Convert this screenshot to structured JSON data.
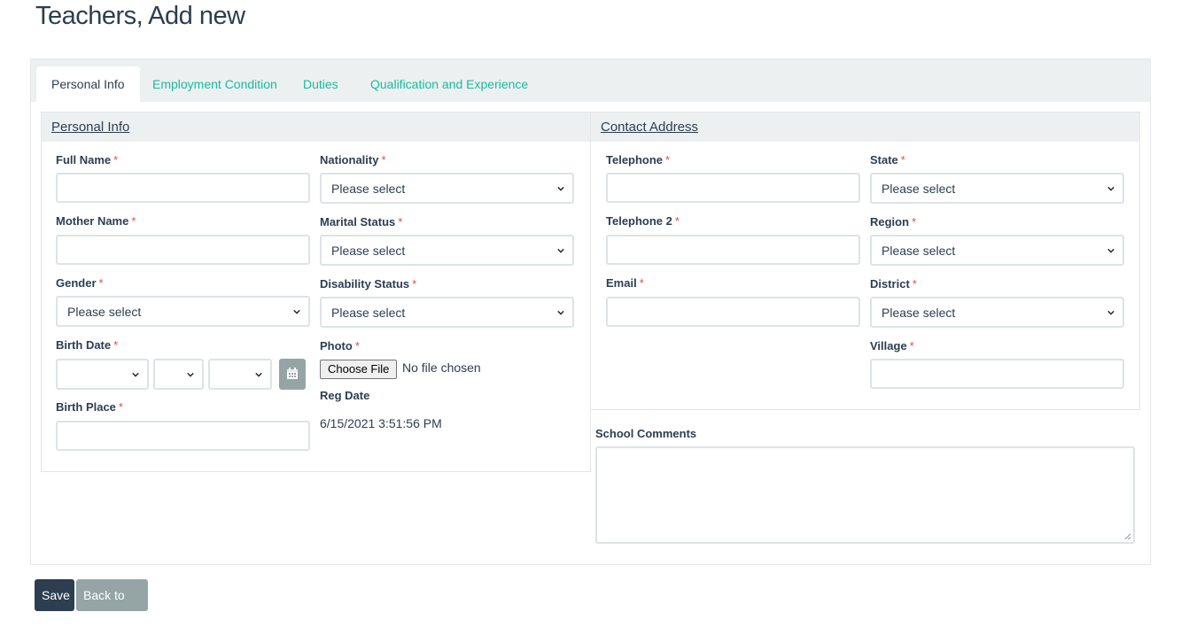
{
  "page": {
    "title": "Teachers, Add new"
  },
  "tabs": [
    {
      "label": "Personal Info"
    },
    {
      "label": "Employment Condition"
    },
    {
      "label": "Duties"
    },
    {
      "label": "Qualification and Experience"
    }
  ],
  "personal": {
    "header": "Personal Info",
    "full_name_label": "Full Name",
    "mother_name_label": "Mother Name",
    "gender_label": "Gender",
    "gender_value": "Please select",
    "birth_date_label": "Birth Date",
    "birth_place_label": "Birth Place",
    "nationality_label": "Nationality",
    "nationality_value": "Please select",
    "marital_status_label": "Marital Status",
    "marital_status_value": "Please select",
    "disability_status_label": "Disability Status",
    "disability_status_value": "Please select",
    "photo_label": "Photo",
    "choose_file_label": "Choose File",
    "no_file_text": "No file chosen",
    "reg_date_label": "Reg Date",
    "reg_date_value": "6/15/2021 3:51:56 PM"
  },
  "contact": {
    "header": "Contact Address",
    "telephone_label": "Telephone",
    "telephone2_label": "Telephone 2",
    "email_label": "Email",
    "state_label": "State",
    "state_value": "Please select",
    "region_label": "Region",
    "region_value": "Please select",
    "district_label": "District",
    "district_value": "Please select",
    "village_label": "Village"
  },
  "comments": {
    "label": "School Comments"
  },
  "required_marker": "*",
  "buttons": {
    "save": "Save",
    "back": "Back to list"
  },
  "icons": {
    "chevron": "chevron-down-icon",
    "calendar": "calendar-icon"
  },
  "colors": {
    "accent": "#18bc9c",
    "primary": "#2c3e50",
    "secondary": "#95a5a6",
    "required": "#e74c3c"
  }
}
